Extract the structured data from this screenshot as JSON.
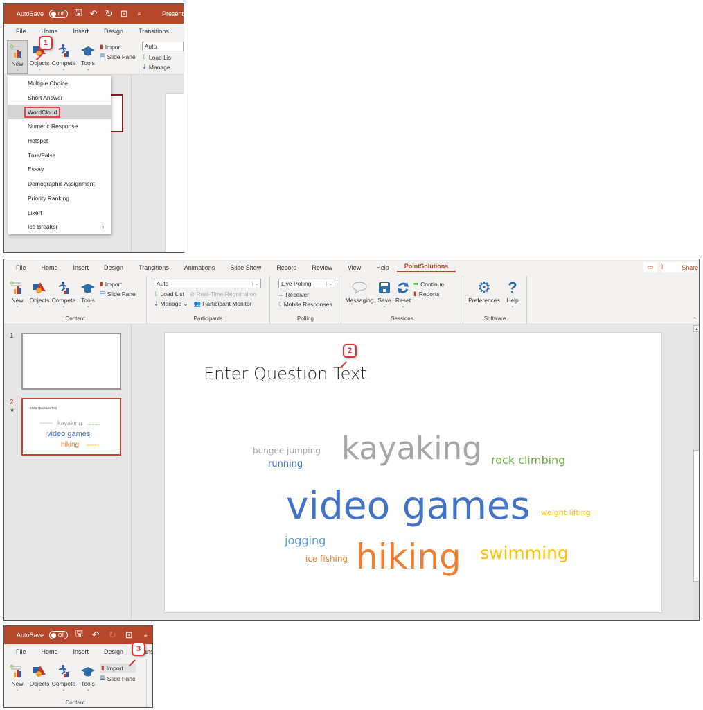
{
  "colors": {
    "title_bar": "#b7472a",
    "accent": "#b7472a",
    "callout": "#d9323b",
    "word_gray": "#a6a6a6",
    "word_blue": "#4472c4",
    "word_lightblue": "#5b9bd5",
    "word_green": "#70ad47",
    "word_orange": "#ed7d31",
    "word_yellow": "#ffc000"
  },
  "titlebar": {
    "autosave_label": "AutoSave",
    "autosave_state": "Off",
    "doc_title_partial": "Present"
  },
  "tabs_short": [
    "File",
    "Home",
    "Insert",
    "Design",
    "Transitions"
  ],
  "tabs_full": [
    "File",
    "Home",
    "Insert",
    "Design",
    "Transitions",
    "Animations",
    "Slide Show",
    "Record",
    "Review",
    "View",
    "Help",
    "PointSolutions"
  ],
  "active_tab": "PointSolutions",
  "tabs_step3": [
    "File",
    "Home",
    "Insert",
    "Design",
    "ans"
  ],
  "ribbon": {
    "content": {
      "label": "Content",
      "new": "New",
      "objects": "Objects",
      "compete": "Compete",
      "tools": "Tools",
      "import": "Import",
      "slide_pane": "Slide Pane"
    },
    "participants": {
      "label": "Participants",
      "combo_value": "Auto",
      "load_list": "Load List",
      "realtime_registration": "Real-Time Registration",
      "manage": "Manage",
      "participant_monitor": "Participant Monitor",
      "load_list_partial": "Load Lis",
      "manage_partial": "Manage"
    },
    "polling": {
      "label": "Polling",
      "combo_value": "Live Polling",
      "receiver": "Receiver",
      "mobile_responses": "Mobile Responses"
    },
    "sessions": {
      "label": "Sessions",
      "messaging": "Messaging",
      "save": "Save",
      "reset": "Reset",
      "continue": "Continue",
      "reports": "Reports"
    },
    "software": {
      "label": "Software",
      "preferences": "Preferences",
      "help": "Help"
    },
    "share": "Share"
  },
  "new_menu": {
    "items": [
      {
        "label": "Multiple Choice"
      },
      {
        "label": "Short Answer"
      },
      {
        "label": "WordCloud",
        "highlighted": true
      },
      {
        "label": "Numeric Response"
      },
      {
        "label": "Hotspot"
      },
      {
        "label": "True/False"
      },
      {
        "label": "Essay"
      },
      {
        "label": "Demographic Assignment"
      },
      {
        "label": "Priority Ranking"
      },
      {
        "label": "Likert"
      },
      {
        "label": "Ice Breaker",
        "submenu": true
      }
    ]
  },
  "callouts": [
    "1",
    "2",
    "3"
  ],
  "slides": {
    "numbers": [
      "1",
      "2"
    ],
    "selected": "2"
  },
  "slide": {
    "question": "Enter Question Text",
    "words": [
      {
        "text": "bungee jumping",
        "color": "#a6a6a6"
      },
      {
        "text": "running",
        "color": "#4472c4"
      },
      {
        "text": "kayaking",
        "color": "#a6a6a6"
      },
      {
        "text": "rock climbing",
        "color": "#70ad47"
      },
      {
        "text": "video games",
        "color": "#4472c4"
      },
      {
        "text": "weight lifting",
        "color": "#ffc000"
      },
      {
        "text": "jogging",
        "color": "#5b9bd5"
      },
      {
        "text": "ice fishing",
        "color": "#ed7d31"
      },
      {
        "text": "hiking",
        "color": "#ed7d31"
      },
      {
        "text": "swimming",
        "color": "#ffc000"
      }
    ]
  }
}
